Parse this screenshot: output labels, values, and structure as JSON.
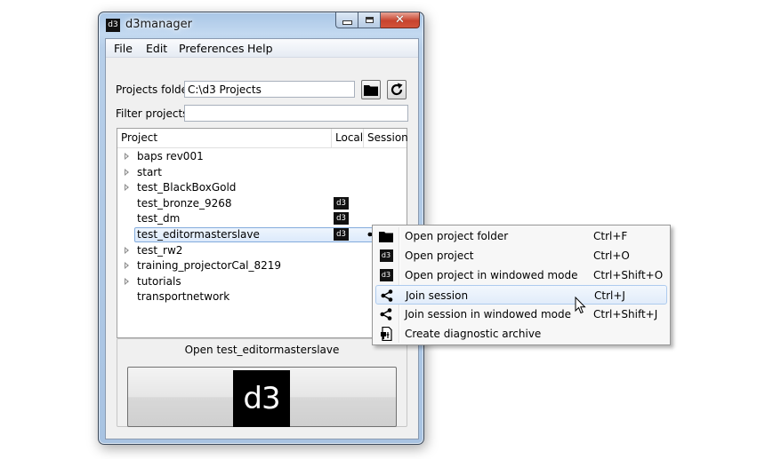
{
  "window": {
    "title": "d3manager",
    "app_icon_text": "d3",
    "close_glyph": "✕"
  },
  "menubar": {
    "items": [
      "File",
      "Edit",
      "Preferences",
      "Help"
    ]
  },
  "projects_folder": {
    "label": "Projects folder",
    "value": "C:\\d3 Projects"
  },
  "filter": {
    "label": "Filter projects",
    "value": ""
  },
  "tree": {
    "columns": [
      "Project",
      "Local",
      "Session"
    ],
    "badge_text": "d3",
    "rows": [
      {
        "name": "baps rev001",
        "expandable": true,
        "local": false,
        "session": false
      },
      {
        "name": "start",
        "expandable": true,
        "local": false,
        "session": false
      },
      {
        "name": "test_BlackBoxGold",
        "expandable": true,
        "local": false,
        "session": false
      },
      {
        "name": "test_bronze_9268",
        "expandable": false,
        "local": true,
        "session": false
      },
      {
        "name": "test_dm",
        "expandable": false,
        "local": true,
        "session": false
      },
      {
        "name": "test_editormasterslave",
        "expandable": false,
        "local": true,
        "session": true,
        "selected": true
      },
      {
        "name": "test_rw2",
        "expandable": true,
        "local": false,
        "session": false
      },
      {
        "name": "training_projectorCal_8219",
        "expandable": true,
        "local": false,
        "session": false
      },
      {
        "name": "tutorials",
        "expandable": true,
        "local": false,
        "session": false
      },
      {
        "name": "transportnetwork",
        "expandable": false,
        "local": false,
        "session": false
      }
    ]
  },
  "open_panel": {
    "label": "Open test_editormasterslave",
    "logo_text": "d3"
  },
  "context_menu": {
    "items": [
      {
        "label": "Open project folder",
        "shortcut": "Ctrl+F",
        "icon": "folder-icon"
      },
      {
        "label": "Open project",
        "shortcut": "Ctrl+O",
        "icon": "d3-icon"
      },
      {
        "label": "Open project in windowed mode",
        "shortcut": "Ctrl+Shift+O",
        "icon": "d3-icon"
      },
      {
        "label": "Join session",
        "shortcut": "Ctrl+J",
        "icon": "share-icon",
        "hover": true
      },
      {
        "label": "Join session in windowed mode",
        "shortcut": "Ctrl+Shift+J",
        "icon": "share-icon"
      },
      {
        "label": "Create diagnostic archive",
        "shortcut": "",
        "icon": "archive-icon"
      }
    ]
  },
  "colors": {
    "selection_border": "#84acdd",
    "close_button": "#c7432d",
    "badge_bg": "#111111"
  }
}
